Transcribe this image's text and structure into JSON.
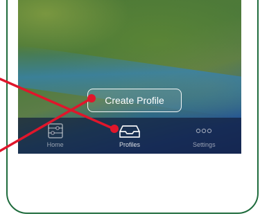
{
  "screen": {
    "create_button_label": "Create Profile"
  },
  "tabbar": {
    "items": [
      {
        "label": "Home",
        "icon": "sliders-icon",
        "active": false
      },
      {
        "label": "Profiles",
        "icon": "tray-icon",
        "active": true
      },
      {
        "label": "Settings",
        "icon": "more-dots-icon",
        "active": false
      }
    ]
  },
  "colors": {
    "frame": "#1e6b3c",
    "annotation": "#e0162b"
  }
}
